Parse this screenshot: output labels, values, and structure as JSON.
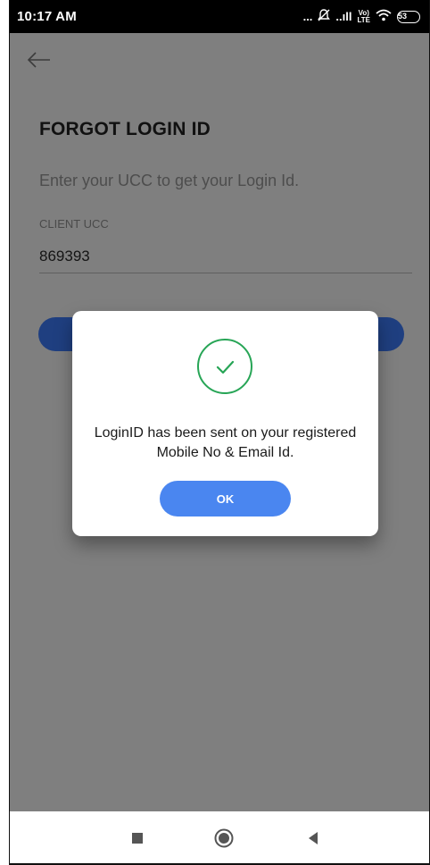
{
  "status_bar": {
    "time": "10:17 AM",
    "dots": "...",
    "signal": "..ıll",
    "lte_top": "Vo)",
    "lte_bottom": "LTE",
    "battery": "53"
  },
  "header": {
    "back_icon": "back-arrow-icon"
  },
  "main": {
    "title": "FORGOT LOGIN ID",
    "subtitle": "Enter your UCC to get your Login Id.",
    "field_label": "CLIENT UCC",
    "field_value": "869393"
  },
  "dialog": {
    "icon": "check-circle-icon",
    "message": "LoginID has been sent on your registered Mobile No & Email Id.",
    "ok_label": "OK"
  },
  "nav": {
    "items": [
      "recents-icon",
      "home-icon",
      "back-icon"
    ]
  },
  "colors": {
    "overlay": "#7f7f7f",
    "accent": "#4a86f0",
    "success": "#27a556",
    "primary_dim": "#1f3f80"
  }
}
